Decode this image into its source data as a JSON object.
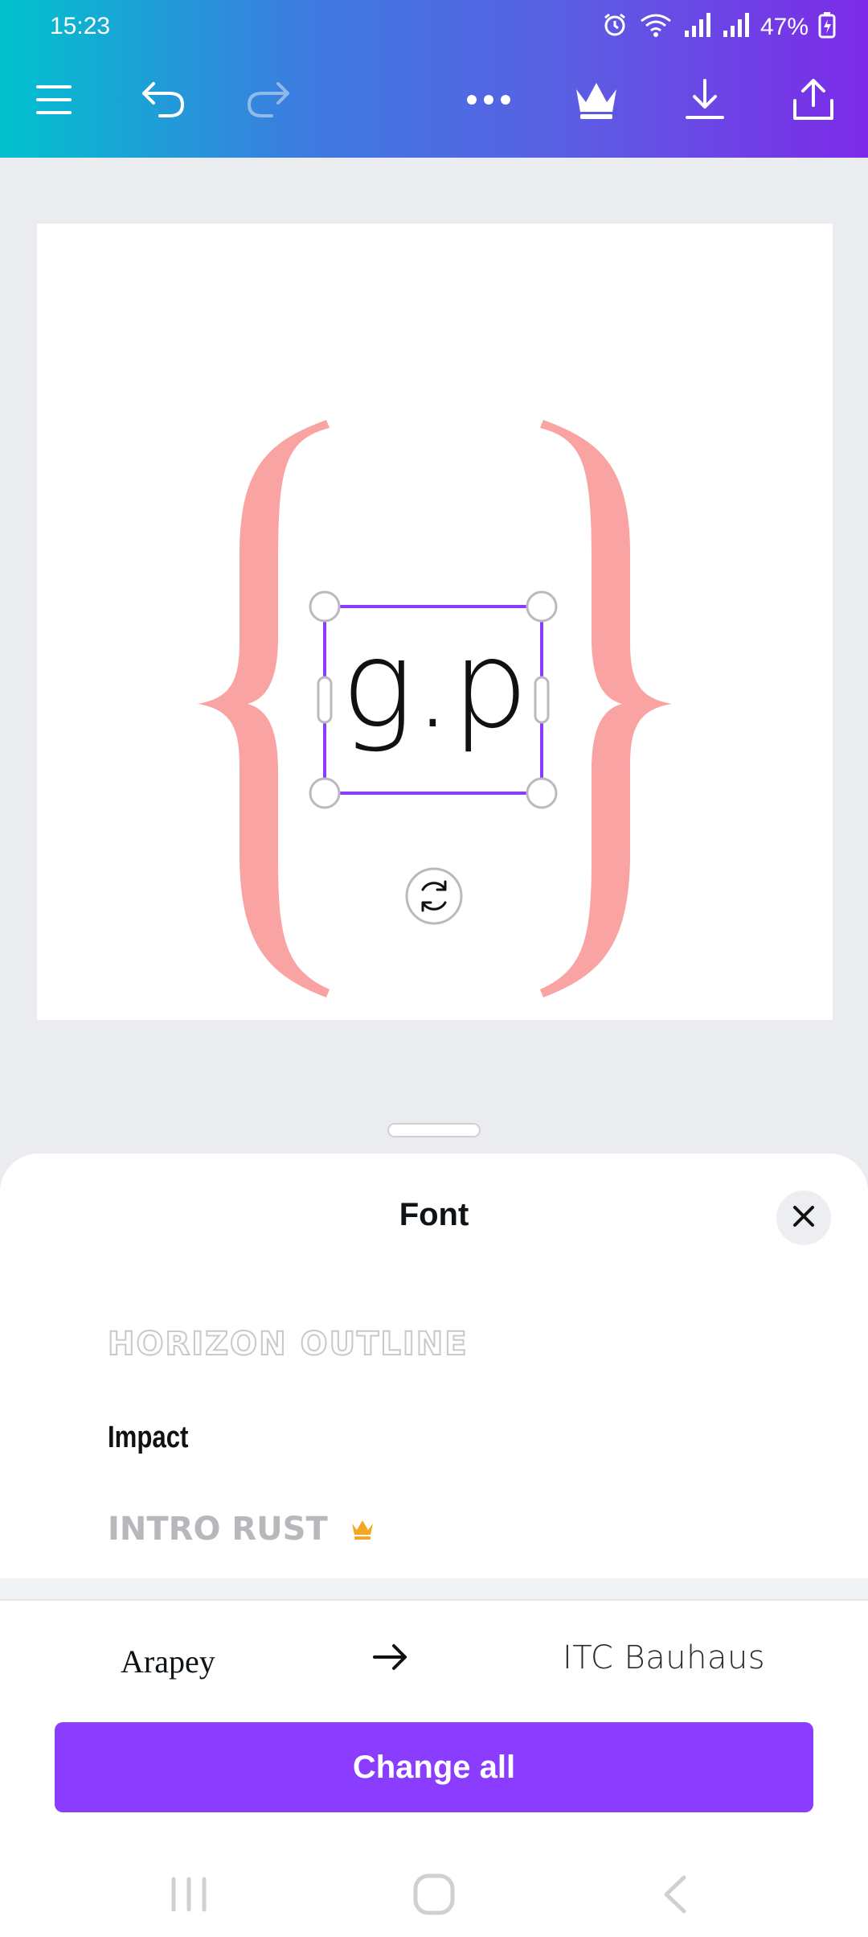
{
  "status_bar": {
    "time": "15:23",
    "battery": "47%"
  },
  "toolbar": {
    "icons": [
      "menu-icon",
      "undo-icon",
      "redo-icon",
      "more-icon",
      "crown-icon",
      "download-icon",
      "share-icon"
    ]
  },
  "canvas": {
    "text": "g.p",
    "bracket_color": "#f9a3a3",
    "selection_color": "#8b3dff"
  },
  "font_panel": {
    "title": "Font",
    "fonts": [
      {
        "label": "HORIZON OUTLINE"
      },
      {
        "label": "Impact"
      },
      {
        "label": "INTRO RUST",
        "premium": true
      }
    ],
    "replace_from": "Arapey",
    "replace_to": "ITC Bauhaus",
    "change_all_label": "Change all"
  },
  "colors": {
    "accent": "#8b3dff",
    "premium": "#f5a623"
  }
}
